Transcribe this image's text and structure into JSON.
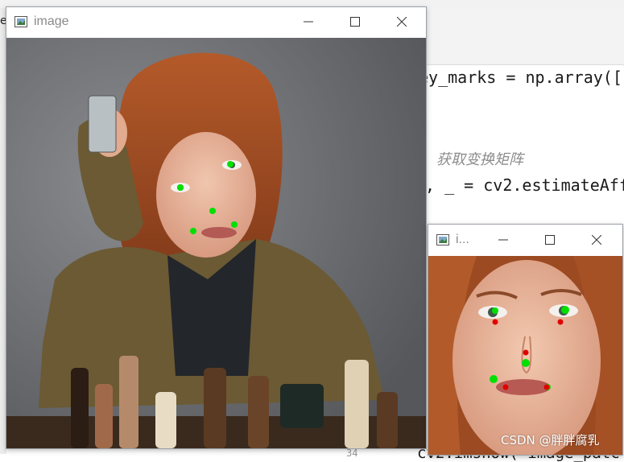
{
  "ide": {
    "stray_char": "e",
    "code_line_1": "ey_marks = np.array([",
    "comment": "获取变换矩阵",
    "code_line_3": ", _ = cv2.estimateAff",
    "code_line_bottom": "cv2.imshow(\"image_patc",
    "line_number": "34"
  },
  "main_window": {
    "title": "image",
    "minimize_icon": "minimize-icon",
    "maximize_icon": "maximize-icon",
    "close_icon": "close-icon"
  },
  "small_window": {
    "title": "i...",
    "minimize_icon": "minimize-icon",
    "maximize_icon": "maximize-icon",
    "close_icon": "close-icon"
  },
  "watermark": "CSDN @胖胖腐乳",
  "colors": {
    "landmark_green": "#00e000",
    "landmark_red": "#e00000",
    "hair": "#9c4a22",
    "background_gray": "#6c6e72",
    "cardigan": "#6b5a33"
  }
}
